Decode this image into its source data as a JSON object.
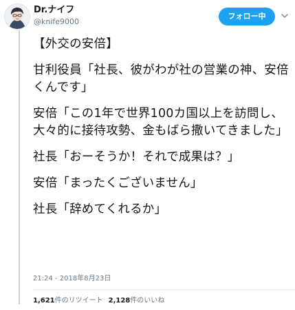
{
  "author": {
    "display_name": "Dr.ナイフ",
    "handle": "@knife9000"
  },
  "follow_button_label": "フォロー中",
  "tweet": {
    "paragraphs": [
      "【外交の安倍】",
      "甘利役員「社長、彼がわが社の営業の神、安倍くんです」",
      "安倍「この1年で世界100カ国以上を訪問し、大々的に接待攻勢、金もばら撒いてきました」",
      "社長「おーそうか！それで成果は？」",
      "安倍「まったくございません」",
      "社長「辞めてくれるか」"
    ],
    "timestamp": "21:24 - 2018年8月23日"
  },
  "stats": {
    "retweets_count": "1,621",
    "retweets_label": "件のリツイート",
    "likes_count": "2,128",
    "likes_label": "件のいいね"
  },
  "colors": {
    "accent": "#1da1f2",
    "text": "#14171a",
    "muted": "#657786"
  },
  "icons": [
    "avatar",
    "chevron-down-icon"
  ]
}
